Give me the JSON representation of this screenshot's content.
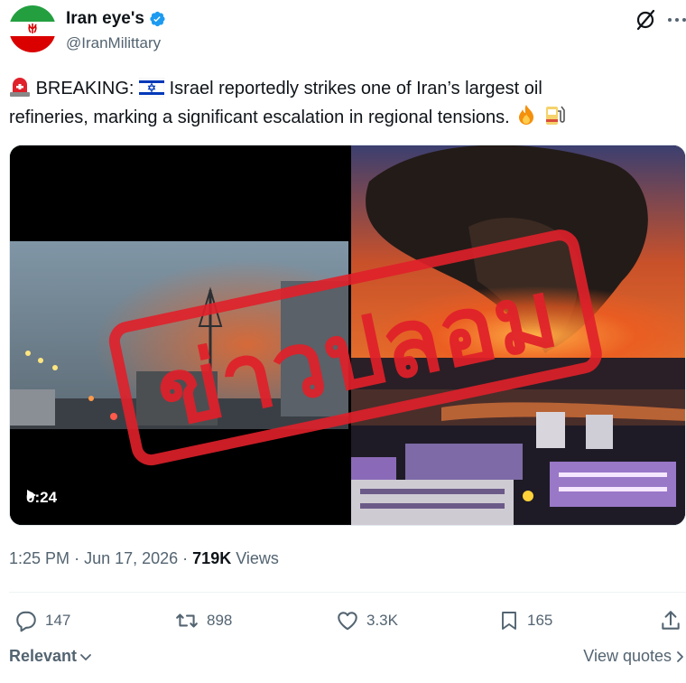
{
  "author": {
    "display_name": "Iran eye's",
    "handle": "@IranMilittary",
    "verified": true,
    "avatar_icon": "iran-flag-icon"
  },
  "tweet": {
    "prefix": "BREAKING:",
    "text_line1": "Israel reportedly strikes one of Iran’s largest oil",
    "text_line2": "refineries, marking a significant escalation in regional tensions.",
    "emojis": [
      "rotating-light-icon",
      "israel-flag-icon",
      "fire-icon",
      "fuel-pump-icon"
    ]
  },
  "media": {
    "duration": "0:24",
    "stamp_text": "ข่าวปลอม",
    "stamp_color": "#e0202a"
  },
  "meta": {
    "time": "1:25 PM",
    "date": "Jun 17, 2026",
    "views_count": "719K",
    "views_label": "Views"
  },
  "actions": {
    "replies": "147",
    "reposts": "898",
    "likes": "3.3K",
    "bookmarks": "165"
  },
  "footer": {
    "sort_label": "Relevant",
    "quotes_label": "View quotes"
  },
  "colors": {
    "text": "#0f1419",
    "secondary": "#536471",
    "verified": "#1d9bf0",
    "divider": "#eff3f4"
  }
}
